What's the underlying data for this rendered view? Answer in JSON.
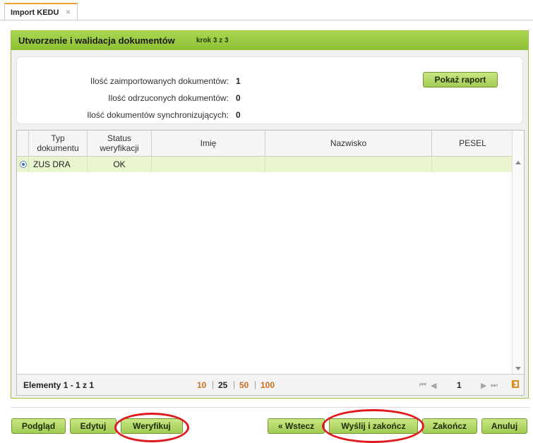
{
  "tab": {
    "label": "Import KEDU",
    "close_symbol": "×"
  },
  "panel": {
    "title": "Utworzenie i walidacja dokumentów",
    "step": "krok 3 z 3"
  },
  "info": {
    "imported_label": "Ilość zaimportowanych dokumentów:",
    "imported_value": "1",
    "rejected_label": "Ilość odrzuconych dokumentów:",
    "rejected_value": "0",
    "sync_label": "Ilość dokumentów synchronizujących:",
    "sync_value": "0",
    "report_button": "Pokaż raport"
  },
  "grid": {
    "columns": [
      "Typ dokumentu",
      "Status weryfikacji",
      "Imię",
      "Nazwisko",
      "PESEL"
    ],
    "rows": [
      {
        "selected": true,
        "type": "ZUS DRA",
        "status": "OK",
        "first_name": "",
        "last_name": "",
        "pesel": ""
      }
    ]
  },
  "pager": {
    "count": "Elementy 1 - 1 z 1",
    "sizes": [
      "10",
      "25",
      "50",
      "100"
    ],
    "current_size": "25",
    "page": "1"
  },
  "footer": {
    "preview": "Podgląd",
    "edit": "Edytuj",
    "verify": "Weryfikuj",
    "back": "« Wstecz",
    "send_finish": "Wyślij i zakończ",
    "finish": "Zakończ",
    "cancel": "Anuluj"
  },
  "colors": {
    "panel_green": "#9ac43e",
    "row_highlight": "#e9f5cf",
    "pager_link": "#c8701e",
    "annotation_red": "#e0191f",
    "tab_accent": "#f0a030"
  }
}
